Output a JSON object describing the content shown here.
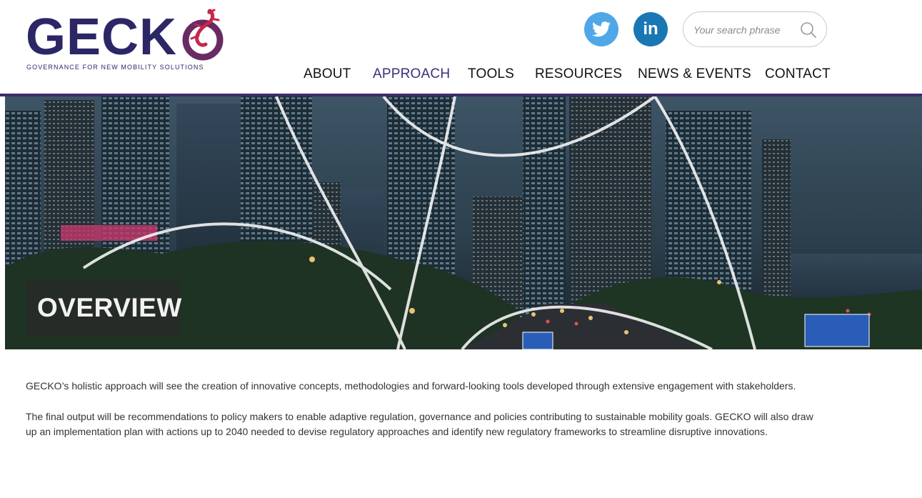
{
  "logo": {
    "word": "GECK",
    "tagline": "GOVERNANCE FOR NEW MOBILITY SOLUTIONS",
    "primary_color": "#2b2766",
    "accent_color": "#c4284b"
  },
  "social": {
    "twitter_icon": "twitter-bird-icon",
    "linkedin_label": "in"
  },
  "search": {
    "placeholder": "Your search phrase",
    "icon": "magnifier-icon"
  },
  "nav": {
    "items": [
      {
        "label": "ABOUT"
      },
      {
        "label": "APPROACH"
      },
      {
        "label": "TOOLS"
      },
      {
        "label": "RESOURCES"
      },
      {
        "label": "NEWS & EVENTS"
      },
      {
        "label": "CONTACT"
      }
    ],
    "active_color": "#3a2f7a"
  },
  "hero": {
    "title": "OVERVIEW"
  },
  "content": {
    "paragraphs": [
      "GECKO’s holistic approach will see the creation of innovative concepts, methodologies and forward-looking tools developed through extensive engagement with stakeholders.",
      "The final output will be recommendations to policy makers to enable adaptive regulation, governance and policies contributing to sustainable mobility goals. GECKO will also draw up an implementation plan with actions up to 2040 needed to devise regulatory approaches and identify new regulatory frameworks to streamline disruptive innovations."
    ]
  },
  "colors": {
    "header_bar": "#3d2b6b",
    "twitter": "#4fa7e8",
    "linkedin": "#1978b4"
  }
}
